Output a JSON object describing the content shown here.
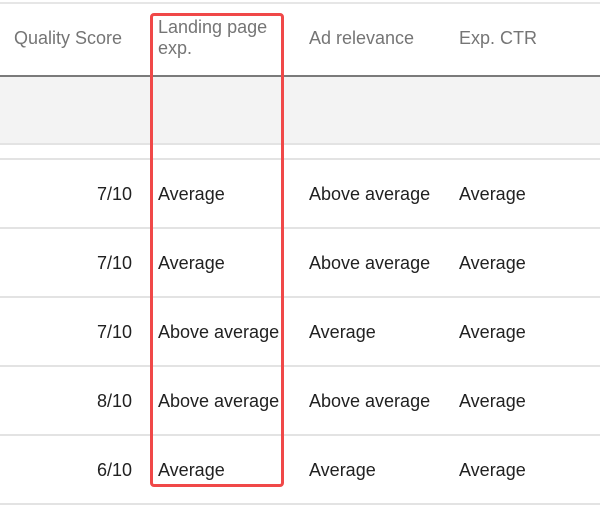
{
  "table": {
    "columns": {
      "quality_score": "Quality Score",
      "landing_page": "Landing page exp.",
      "ad_relevance": "Ad relevance",
      "exp_ctr": "Exp. CTR"
    },
    "rows": [
      {
        "quality_score": "7/10",
        "landing_page": "Average",
        "ad_relevance": "Above average",
        "exp_ctr": "Average"
      },
      {
        "quality_score": "7/10",
        "landing_page": "Average",
        "ad_relevance": "Above average",
        "exp_ctr": "Average"
      },
      {
        "quality_score": "7/10",
        "landing_page": "Above average",
        "ad_relevance": "Average",
        "exp_ctr": "Average"
      },
      {
        "quality_score": "8/10",
        "landing_page": "Above average",
        "ad_relevance": "Above average",
        "exp_ctr": "Average"
      },
      {
        "quality_score": "6/10",
        "landing_page": "Average",
        "ad_relevance": "Average",
        "exp_ctr": "Average"
      }
    ]
  },
  "highlight": {
    "column": "landing_page",
    "color": "#f04848"
  }
}
